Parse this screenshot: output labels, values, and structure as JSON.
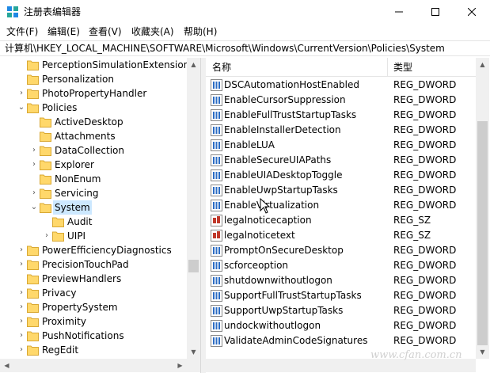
{
  "window": {
    "title": "注册表编辑器",
    "icon": "regedit-icon"
  },
  "menu": [
    "文件(F)",
    "编辑(E)",
    "查看(V)",
    "收藏夹(A)",
    "帮助(H)"
  ],
  "address": "计算机\\HKEY_LOCAL_MACHINE\\SOFTWARE\\Microsoft\\Windows\\CurrentVersion\\Policies\\System",
  "tree": [
    {
      "label": "PerceptionSimulationExtensions",
      "expander": "",
      "selected": false
    },
    {
      "label": "Personalization",
      "expander": "",
      "selected": false
    },
    {
      "label": "PhotoPropertyHandler",
      "expander": "›",
      "selected": false
    },
    {
      "label": "Policies",
      "expander": "⌄",
      "selected": false
    },
    {
      "label": "ActiveDesktop",
      "expander": "",
      "selected": false
    },
    {
      "label": "Attachments",
      "expander": "",
      "selected": false
    },
    {
      "label": "DataCollection",
      "expander": "›",
      "selected": false
    },
    {
      "label": "Explorer",
      "expander": "›",
      "selected": false
    },
    {
      "label": "NonEnum",
      "expander": "",
      "selected": false
    },
    {
      "label": "Servicing",
      "expander": "›",
      "selected": false
    },
    {
      "label": "System",
      "expander": "⌄",
      "selected": true
    },
    {
      "label": "Audit",
      "expander": "",
      "selected": false
    },
    {
      "label": "UIPI",
      "expander": "›",
      "selected": false
    },
    {
      "label": "PowerEfficiencyDiagnostics",
      "expander": "›",
      "selected": false
    },
    {
      "label": "PrecisionTouchPad",
      "expander": "›",
      "selected": false
    },
    {
      "label": "PreviewHandlers",
      "expander": "",
      "selected": false
    },
    {
      "label": "Privacy",
      "expander": "›",
      "selected": false
    },
    {
      "label": "PropertySystem",
      "expander": "›",
      "selected": false
    },
    {
      "label": "Proximity",
      "expander": "›",
      "selected": false
    },
    {
      "label": "PushNotifications",
      "expander": "›",
      "selected": false
    },
    {
      "label": "RegEdit",
      "expander": "›",
      "selected": false
    }
  ],
  "list": {
    "headers": {
      "name": "名称",
      "type": "类型"
    },
    "rows": [
      {
        "name": "DSCAutomationHostEnabled",
        "type": "REG_DWORD",
        "icon": "dword-icon"
      },
      {
        "name": "EnableCursorSuppression",
        "type": "REG_DWORD",
        "icon": "dword-icon"
      },
      {
        "name": "EnableFullTrustStartupTasks",
        "type": "REG_DWORD",
        "icon": "dword-icon"
      },
      {
        "name": "EnableInstallerDetection",
        "type": "REG_DWORD",
        "icon": "dword-icon"
      },
      {
        "name": "EnableLUA",
        "type": "REG_DWORD",
        "icon": "dword-icon"
      },
      {
        "name": "EnableSecureUIAPaths",
        "type": "REG_DWORD",
        "icon": "dword-icon"
      },
      {
        "name": "EnableUIADesktopToggle",
        "type": "REG_DWORD",
        "icon": "dword-icon"
      },
      {
        "name": "EnableUwpStartupTasks",
        "type": "REG_DWORD",
        "icon": "dword-icon"
      },
      {
        "name": "EnableVirtualization",
        "type": "REG_DWORD",
        "icon": "dword-icon"
      },
      {
        "name": "legalnoticecaption",
        "type": "REG_SZ",
        "icon": "string-icon"
      },
      {
        "name": "legalnoticetext",
        "type": "REG_SZ",
        "icon": "string-icon"
      },
      {
        "name": "PromptOnSecureDesktop",
        "type": "REG_DWORD",
        "icon": "dword-icon"
      },
      {
        "name": "scforceoption",
        "type": "REG_DWORD",
        "icon": "dword-icon"
      },
      {
        "name": "shutdownwithoutlogon",
        "type": "REG_DWORD",
        "icon": "dword-icon"
      },
      {
        "name": "SupportFullTrustStartupTasks",
        "type": "REG_DWORD",
        "icon": "dword-icon"
      },
      {
        "name": "SupportUwpStartupTasks",
        "type": "REG_DWORD",
        "icon": "dword-icon"
      },
      {
        "name": "undockwithoutlogon",
        "type": "REG_DWORD",
        "icon": "dword-icon"
      },
      {
        "name": "ValidateAdminCodeSignatures",
        "type": "REG_DWORD",
        "icon": "dword-icon"
      }
    ]
  },
  "watermark": "www.cfan.com.cn",
  "colors": {
    "selection": "#cce8ff",
    "folder": "#ffd86b",
    "dword_icon": "#2b6cc4",
    "string_icon": "#c0392b"
  }
}
